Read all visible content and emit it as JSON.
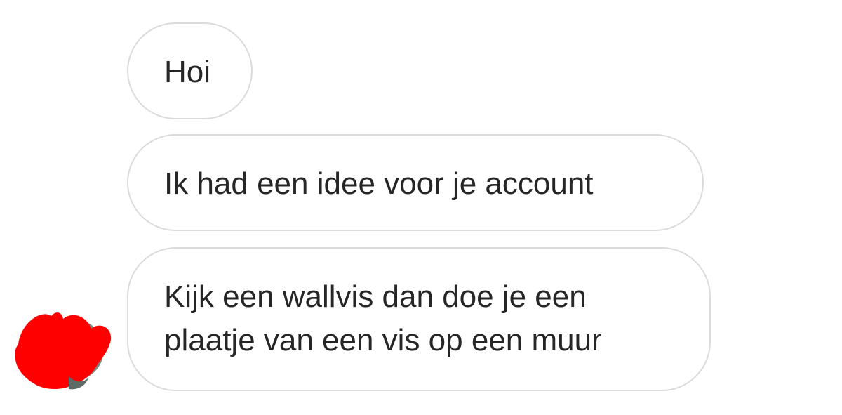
{
  "messages": [
    {
      "text": "Hoi"
    },
    {
      "text": "Ik had een idee voor je account"
    },
    {
      "text": "Kijk een wallvis dan doe je een\nplaatje van een vis op een muur"
    }
  ],
  "avatar": {
    "icon": "redacted-avatar",
    "redaction_color": "#ff0000"
  }
}
